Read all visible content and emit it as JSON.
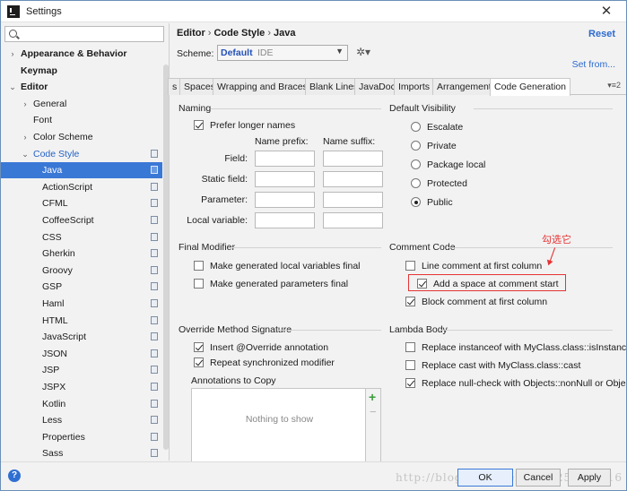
{
  "window": {
    "title": "Settings"
  },
  "search": {
    "placeholder": ""
  },
  "tree": [
    {
      "label": "Appearance & Behavior",
      "bold": true,
      "arrow": "›",
      "indent": 0
    },
    {
      "label": "Keymap",
      "bold": true,
      "arrow": "",
      "indent": 0
    },
    {
      "label": "Editor",
      "bold": true,
      "arrow": "⌄",
      "indent": 0
    },
    {
      "label": "General",
      "arrow": "›",
      "indent": 1
    },
    {
      "label": "Font",
      "arrow": "",
      "indent": 1
    },
    {
      "label": "Color Scheme",
      "arrow": "›",
      "indent": 1
    },
    {
      "label": "Code Style",
      "arrow": "⌄",
      "indent": 1,
      "blue": true,
      "copy": true
    },
    {
      "label": "Java",
      "indent": 2,
      "selected": true,
      "copy": true
    },
    {
      "label": "ActionScript",
      "indent": 2,
      "copy": true
    },
    {
      "label": "CFML",
      "indent": 2,
      "copy": true
    },
    {
      "label": "CoffeeScript",
      "indent": 2,
      "copy": true
    },
    {
      "label": "CSS",
      "indent": 2,
      "copy": true
    },
    {
      "label": "Gherkin",
      "indent": 2,
      "copy": true
    },
    {
      "label": "Groovy",
      "indent": 2,
      "copy": true
    },
    {
      "label": "GSP",
      "indent": 2,
      "copy": true
    },
    {
      "label": "Haml",
      "indent": 2,
      "copy": true
    },
    {
      "label": "HTML",
      "indent": 2,
      "copy": true
    },
    {
      "label": "JavaScript",
      "indent": 2,
      "copy": true
    },
    {
      "label": "JSON",
      "indent": 2,
      "copy": true
    },
    {
      "label": "JSP",
      "indent": 2,
      "copy": true
    },
    {
      "label": "JSPX",
      "indent": 2,
      "copy": true
    },
    {
      "label": "Kotlin",
      "indent": 2,
      "copy": true
    },
    {
      "label": "Less",
      "indent": 2,
      "copy": true
    },
    {
      "label": "Properties",
      "indent": 2,
      "copy": true
    },
    {
      "label": "Sass",
      "indent": 2,
      "copy": true
    }
  ],
  "header": {
    "crumb1": "Editor",
    "sep": "›",
    "crumb2": "Code Style",
    "crumb3": "Java",
    "reset": "Reset",
    "scheme_label": "Scheme:",
    "scheme_name": "Default",
    "scheme_sub": "IDE",
    "set_from": "Set from..."
  },
  "tabs": [
    {
      "label": "s"
    },
    {
      "label": "Spaces"
    },
    {
      "label": "Wrapping and Braces"
    },
    {
      "label": "Blank Lines"
    },
    {
      "label": "JavaDoc"
    },
    {
      "label": "Imports"
    },
    {
      "label": "Arrangement"
    },
    {
      "label": "Code Generation",
      "active": true
    }
  ],
  "tabs_more": "▾≡2",
  "naming": {
    "title": "Naming",
    "prefer_longer": "Prefer longer names",
    "prefer_longer_checked": true,
    "prefix_header": "Name prefix:",
    "suffix_header": "Name suffix:",
    "rows": [
      "Field:",
      "Static field:",
      "Parameter:",
      "Local variable:"
    ]
  },
  "default_visibility": {
    "title": "Default Visibility",
    "options": [
      "Escalate",
      "Private",
      "Package local",
      "Protected",
      "Public"
    ],
    "selected": "Public"
  },
  "final_modifier": {
    "title": "Final Modifier",
    "items": [
      {
        "label": "Make generated local variables final",
        "checked": false
      },
      {
        "label": "Make generated parameters final",
        "checked": false
      }
    ]
  },
  "comment_code": {
    "title": "Comment Code",
    "items": [
      {
        "label": "Line comment at first column",
        "checked": false
      },
      {
        "label": "Add a space at comment start",
        "checked": true
      },
      {
        "label": "Block comment at first column",
        "checked": true
      }
    ]
  },
  "override": {
    "title": "Override Method Signature",
    "items": [
      {
        "label": "Insert @Override annotation",
        "checked": true
      },
      {
        "label": "Repeat synchronized modifier",
        "checked": true
      }
    ],
    "annotations_label": "Annotations to Copy",
    "empty_text": "Nothing to show"
  },
  "lambda": {
    "title": "Lambda Body",
    "items": [
      {
        "label": "Replace instanceof with MyClass.class::isInstance",
        "checked": false
      },
      {
        "label": "Replace cast with MyClass.class::cast",
        "checked": false
      },
      {
        "label": "Replace null-check with Objects::nonNull or Objects::",
        "checked": true
      }
    ]
  },
  "annotation_note": "勾选它",
  "buttons": {
    "ok": "OK",
    "cancel": "Cancel",
    "apply": "Apply"
  },
  "watermark": "http://blog.csdn.net/u012251638/16",
  "colors": {
    "accent": "#3a78d6",
    "link": "#2c6ad1",
    "annotation": "#e53434"
  }
}
